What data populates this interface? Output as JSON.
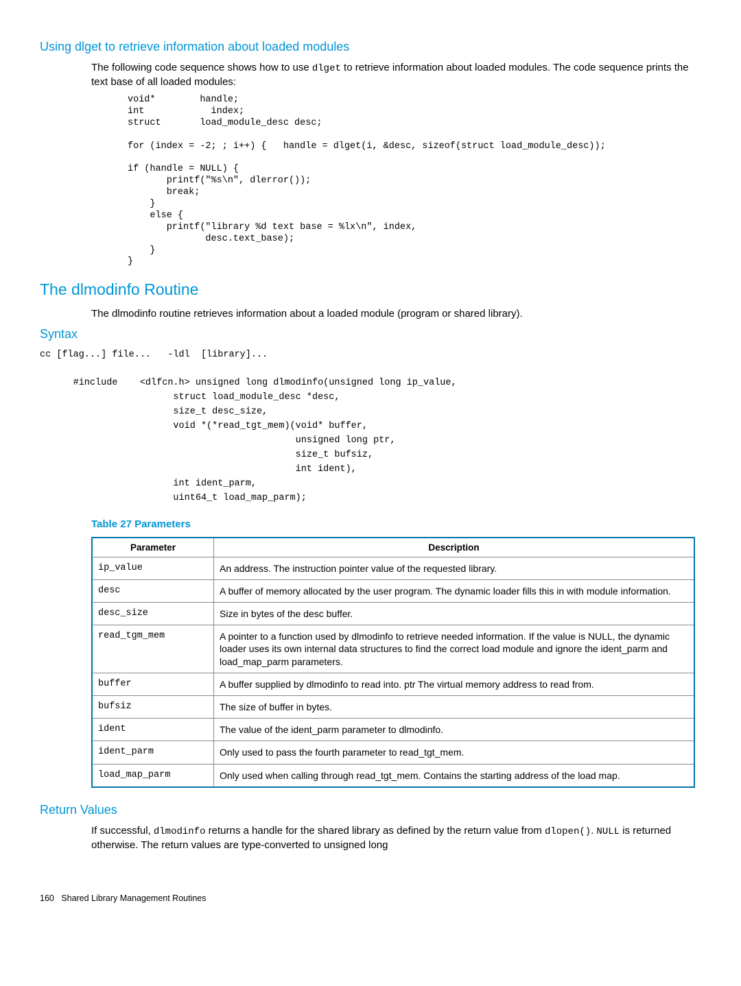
{
  "section1": {
    "heading": "Using dlget to retrieve information about loaded modules",
    "para_prefix": "The following code sequence shows how to use ",
    "para_code": "dlget",
    "para_suffix": " to retrieve information about loaded modules. The code sequence prints the text base of all loaded modules:",
    "code": "void*        handle;\nint            index;\nstruct       load_module_desc desc;\n\nfor (index = -2; ; i++) {   handle = dlget(i, &desc, sizeof(struct load_module_desc));\n\nif (handle = NULL) {\n       printf(\"%s\\n\", dlerror());\n       break;\n    }\n    else {\n       printf(\"library %d text base = %lx\\n\", index,\n              desc.text_base);\n    }\n}"
  },
  "section2": {
    "heading": "The dlmodinfo Routine",
    "para": "The dlmodinfo routine retrieves information about a loaded module (program or shared library)."
  },
  "syntax": {
    "heading": "Syntax",
    "code": "cc [flag...] file...   -ldl  [library]...\n\n      #include    <dlfcn.h> unsigned long dlmodinfo(unsigned long ip_value,\n                        struct load_module_desc *desc,\n                        size_t desc_size,\n                        void *(*read_tgt_mem)(void* buffer,\n                                              unsigned long ptr,\n                                              size_t bufsiz,\n                                              int ident),\n                        int ident_parm,\n                        uint64_t load_map_parm);"
  },
  "table": {
    "title": "Table 27 Parameters",
    "header_param": "Parameter",
    "header_desc": "Description",
    "rows": [
      {
        "param": "ip_value",
        "desc": "An address. The instruction pointer value of the requested library."
      },
      {
        "param": "desc",
        "desc": "A buffer of memory allocated by the user program. The dynamic loader fills this in with module information."
      },
      {
        "param": "desc_size",
        "desc": "Size in bytes of the desc buffer."
      },
      {
        "param": "read_tgm_mem",
        "desc": "A pointer to a function used by dlmodinfo to retrieve needed information. If the value is NULL, the dynamic loader uses its own internal data structures to find the correct load module and ignore the ident_parm and load_map_parm parameters."
      },
      {
        "param": "buffer",
        "desc": "A buffer supplied by dlmodinfo to read into. ptr The virtual memory address to read from."
      },
      {
        "param": "bufsiz",
        "desc": "The size of buffer in bytes."
      },
      {
        "param": "ident",
        "desc": "The value of the ident_parm parameter to dlmodinfo."
      },
      {
        "param": "ident_parm",
        "desc": "Only used to pass the fourth parameter to read_tgt_mem."
      },
      {
        "param": "load_map_parm",
        "desc": "Only used when calling through read_tgt_mem. Contains the starting address of the load map."
      }
    ]
  },
  "return": {
    "heading": "Return Values",
    "prefix": "If successful, ",
    "code1": "dlmodinfo",
    "mid1": " returns a handle for the shared library as defined by the return value from ",
    "code2": "dlopen()",
    "mid2": ". ",
    "code3": "NULL",
    "suffix": " is returned otherwise. The return values are type-converted to unsigned long"
  },
  "footer": {
    "page": "160",
    "text": "Shared Library Management Routines"
  }
}
